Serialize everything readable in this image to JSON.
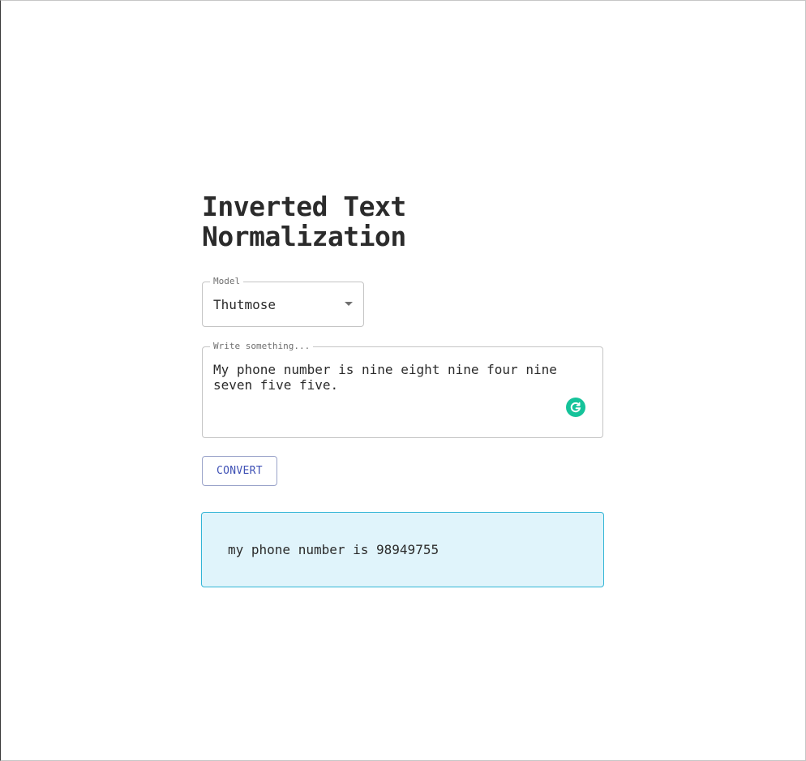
{
  "header": {
    "title": "Inverted Text Normalization"
  },
  "model_select": {
    "label": "Model",
    "value": "Thutmose"
  },
  "input": {
    "label": "Write something...",
    "value": "My phone number is nine eight nine four nine seven five five."
  },
  "actions": {
    "convert_label": "CONVERT"
  },
  "result": {
    "text": "my phone number is 98949755"
  },
  "colors": {
    "accent": "#3f51b5",
    "result_bg": "#e0f4fb",
    "result_border": "#33b5d6",
    "grammarly": "#15c39a"
  },
  "icons": {
    "select_caret": "chevron-down-icon",
    "grammarly": "grammarly-icon"
  }
}
